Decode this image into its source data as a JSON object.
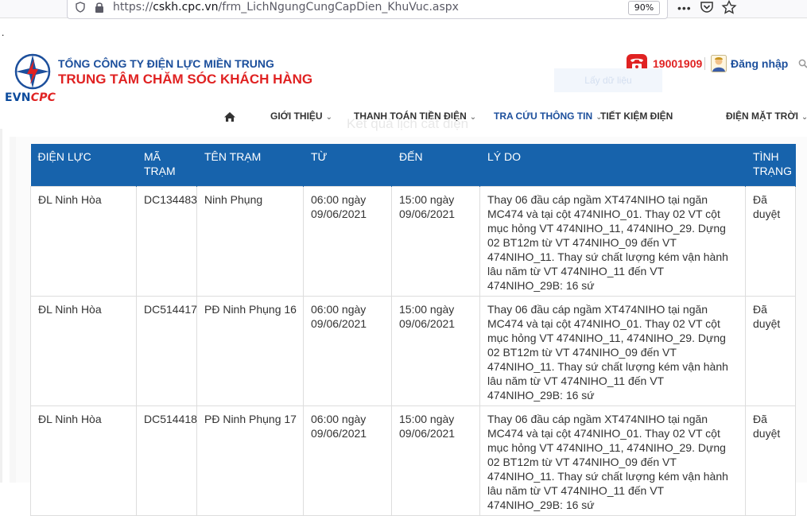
{
  "browser": {
    "url_prefix": "https://",
    "url_host": "cskh.cpc.vn",
    "url_path": "/frm_LichNgungCungCapDien_KhuVuc.aspx",
    "zoom": "90%"
  },
  "header": {
    "org_name": "TỔNG CÔNG TY ĐIỆN LỰC MIỀN TRUNG",
    "center_name": "TRUNG TÂM CHĂM SÓC KHÁCH HÀNG",
    "logo_evn": "EVN",
    "logo_cpc": "CPC",
    "hotline": "19001909",
    "login_label": "Đăng nhập",
    "ghost_button": "Lấy dữ liệu"
  },
  "nav": {
    "items": [
      {
        "label": "GIỚI THIỆU",
        "has_caret": true
      },
      {
        "label": "THANH TOÁN TIỀN ĐIỆN",
        "has_caret": true
      },
      {
        "label": "TRA CỨU THÔNG TIN",
        "has_caret": true,
        "active": true
      },
      {
        "label": "TIẾT KIỆM ĐIỆN",
        "has_caret": false
      },
      {
        "label": "ĐIỆN MẶT TRỜI",
        "has_caret": true
      }
    ],
    "caret": "⌄",
    "ghost_heading": "Kết quả lịch cắt điện"
  },
  "table": {
    "columns": [
      "ĐIỆN LỰC",
      "MÃ TRẠM",
      "TÊN TRẠM",
      "TỪ",
      "ĐẾN",
      "LÝ DO",
      "TÌNH TRẠNG"
    ],
    "rows": [
      {
        "dien_luc": "ĐL Ninh Hòa",
        "ma_tram": "DC134483",
        "ten_tram": "Ninh Phụng",
        "tu": "06:00 ngày 09/06/2021",
        "den": "15:00 ngày 09/06/2021",
        "ly_do": "Thay 06 đầu cáp ngầm XT474NIHO tại ngăn MC474 và tại cột 474NIHO_01. Thay 02 VT cột mục hỏng VT 474NIHO_11, 474NIHO_29. Dựng 02 BT12m từ VT 474NIHO_09 đến VT 474NIHO_11. Thay sứ chất lượng kém vận hành lâu năm từ VT 474NIHO_11 đến VT 474NIHO_29B: 16 sứ",
        "tinh_trang": "Đã duyệt"
      },
      {
        "dien_luc": "ĐL Ninh Hòa",
        "ma_tram": "DC514417",
        "ten_tram": "PĐ Ninh Phụng 16",
        "tu": "06:00 ngày 09/06/2021",
        "den": "15:00 ngày 09/06/2021",
        "ly_do": "Thay 06 đầu cáp ngầm XT474NIHO tại ngăn MC474 và tại cột 474NIHO_01. Thay 02 VT cột mục hỏng VT 474NIHO_11, 474NIHO_29. Dựng 02 BT12m từ VT 474NIHO_09 đến VT 474NIHO_11. Thay sứ chất lượng kém vận hành lâu năm từ VT 474NIHO_11 đến VT 474NIHO_29B: 16 sứ",
        "tinh_trang": "Đã duyệt"
      },
      {
        "dien_luc": "ĐL Ninh Hòa",
        "ma_tram": "DC514418",
        "ten_tram": "PĐ Ninh Phụng 17",
        "tu": "06:00 ngày 09/06/2021",
        "den": "15:00 ngày 09/06/2021",
        "ly_do": "Thay 06 đầu cáp ngầm XT474NIHO tại ngăn MC474 và tại cột 474NIHO_01. Thay 02 VT cột mục hỏng VT 474NIHO_11, 474NIHO_29. Dựng 02 BT12m từ VT 474NIHO_09 đến VT 474NIHO_11. Thay sứ chất lượng kém vận hành lâu năm từ VT 474NIHO_11 đến VT 474NIHO_29B: 16 sứ",
        "tinh_trang": "Đã duyệt"
      }
    ]
  },
  "colors": {
    "brand_blue": "#1c4f9c",
    "brand_red": "#e02222",
    "table_header": "#1763ac"
  },
  "icons": [
    "shield-icon",
    "lock-icon",
    "pocket-icon",
    "star-icon",
    "phone-icon",
    "user-avatar-icon",
    "search-icon",
    "home-icon"
  ]
}
